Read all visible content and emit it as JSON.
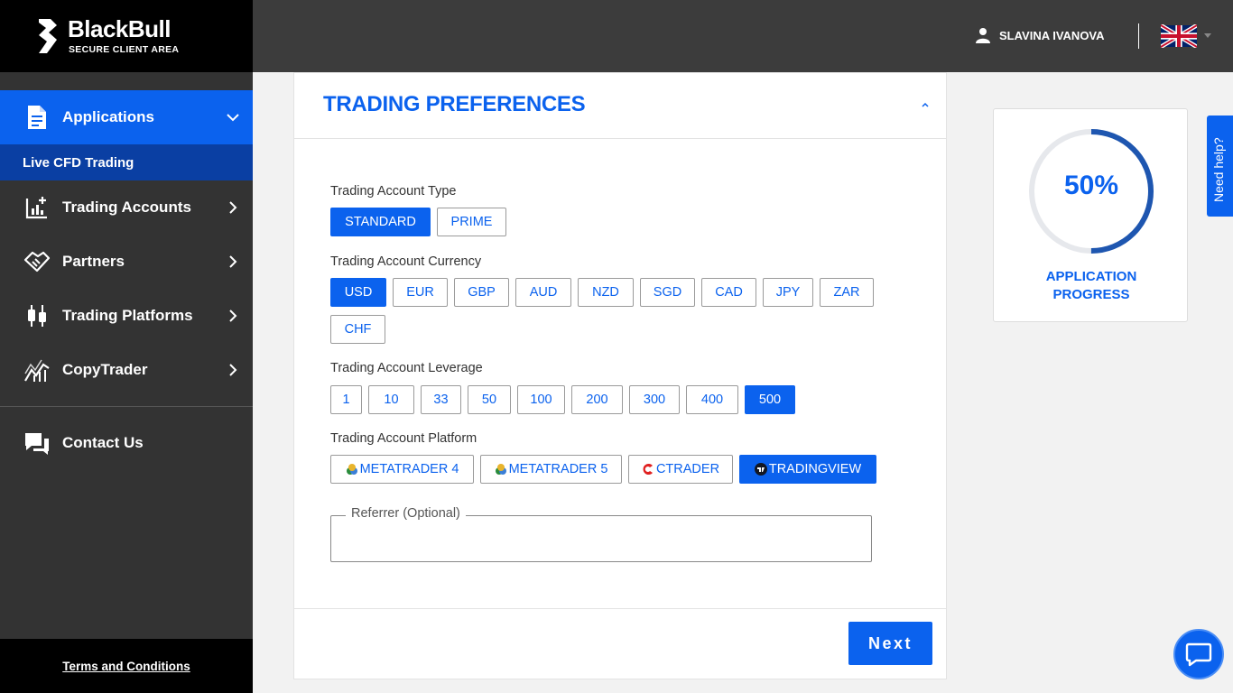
{
  "brand": {
    "name": "BlackBull",
    "subtitle": "SECURE CLIENT AREA"
  },
  "sidebar": {
    "items": [
      {
        "label": "Applications",
        "icon": "document-icon",
        "active": true
      },
      {
        "label": "Trading Accounts",
        "icon": "chart-plus-icon"
      },
      {
        "label": "Partners",
        "icon": "handshake-icon"
      },
      {
        "label": "Trading Platforms",
        "icon": "candlestick-icon"
      },
      {
        "label": "CopyTrader",
        "icon": "trend-line-icon"
      }
    ],
    "sub_item": "Live CFD Trading",
    "contact": "Contact Us",
    "terms": "Terms and Conditions"
  },
  "header": {
    "user_name": "SLAVINA IVANOVA",
    "language_flag": "uk-flag-icon"
  },
  "form": {
    "title": "TRADING PREFERENCES",
    "account_type": {
      "label": "Trading Account Type",
      "options": [
        "STANDARD",
        "PRIME"
      ],
      "selected": "STANDARD"
    },
    "currency": {
      "label": "Trading Account Currency",
      "options": [
        "USD",
        "EUR",
        "GBP",
        "AUD",
        "NZD",
        "SGD",
        "CAD",
        "JPY",
        "ZAR",
        "CHF"
      ],
      "selected": "USD"
    },
    "leverage": {
      "label": "Trading Account Leverage",
      "options": [
        "1",
        "10",
        "33",
        "50",
        "100",
        "200",
        "300",
        "400",
        "500"
      ],
      "selected": "500"
    },
    "platform": {
      "label": "Trading Account Platform",
      "options": [
        "METATRADER 4",
        "METATRADER 5",
        "CTRADER",
        "TRADINGVIEW"
      ],
      "selected": "TRADINGVIEW"
    },
    "referrer": {
      "label": "Referrer (Optional)",
      "value": ""
    },
    "next": "Next"
  },
  "progress": {
    "value": 50,
    "value_text": "50%",
    "label_line1": "APPLICATION",
    "label_line2": "PROGRESS"
  },
  "help": "Need help?",
  "colors": {
    "accent": "#0b62ee",
    "sidebar": "#333333",
    "topbar": "#3c3c3c",
    "progress_ring": "#1e56b0"
  }
}
